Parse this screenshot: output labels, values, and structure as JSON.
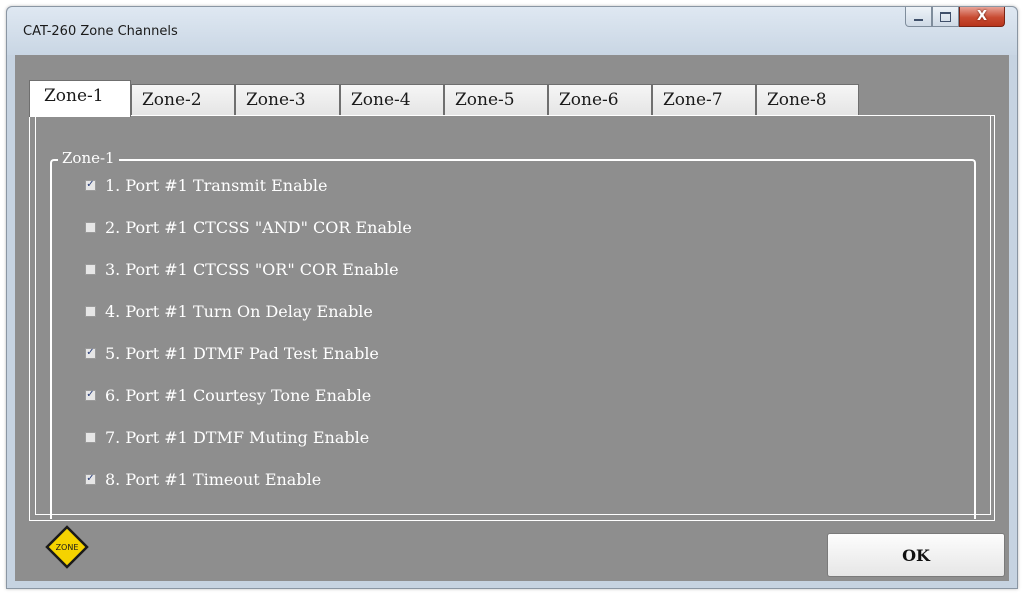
{
  "window": {
    "title": "CAT-260 Zone Channels",
    "controls": {
      "minimize_icon": "minimize-icon",
      "maximize_icon": "maximize-icon",
      "close_glyph": "X"
    }
  },
  "tabs": [
    {
      "label": "Zone-1",
      "active": true
    },
    {
      "label": "Zone-2",
      "active": false
    },
    {
      "label": "Zone-3",
      "active": false
    },
    {
      "label": "Zone-4",
      "active": false
    },
    {
      "label": "Zone-5",
      "active": false
    },
    {
      "label": "Zone-6",
      "active": false
    },
    {
      "label": "Zone-7",
      "active": false
    },
    {
      "label": "Zone-8",
      "active": false
    }
  ],
  "group": {
    "legend": "Zone-1",
    "items": [
      {
        "label": "1. Port #1 Transmit Enable",
        "checked": true
      },
      {
        "label": "2. Port #1 CTCSS \"AND\" COR Enable",
        "checked": false
      },
      {
        "label": "3. Port #1 CTCSS \"OR\" COR Enable",
        "checked": false
      },
      {
        "label": "4. Port #1 Turn On Delay Enable",
        "checked": false
      },
      {
        "label": "5. Port #1 DTMF Pad Test Enable",
        "checked": true
      },
      {
        "label": "6. Port #1 Courtesy Tone Enable",
        "checked": true
      },
      {
        "label": "7. Port #1 DTMF Muting Enable",
        "checked": false
      },
      {
        "label": "8. Port #1 Timeout Enable",
        "checked": true
      }
    ]
  },
  "badge": {
    "text": "ZONE",
    "color": "#f5d300"
  },
  "ok_button": {
    "label": "OK"
  },
  "colors": {
    "panel_bg": "#8e8e8e",
    "check_mark": "#2a3f7a"
  }
}
